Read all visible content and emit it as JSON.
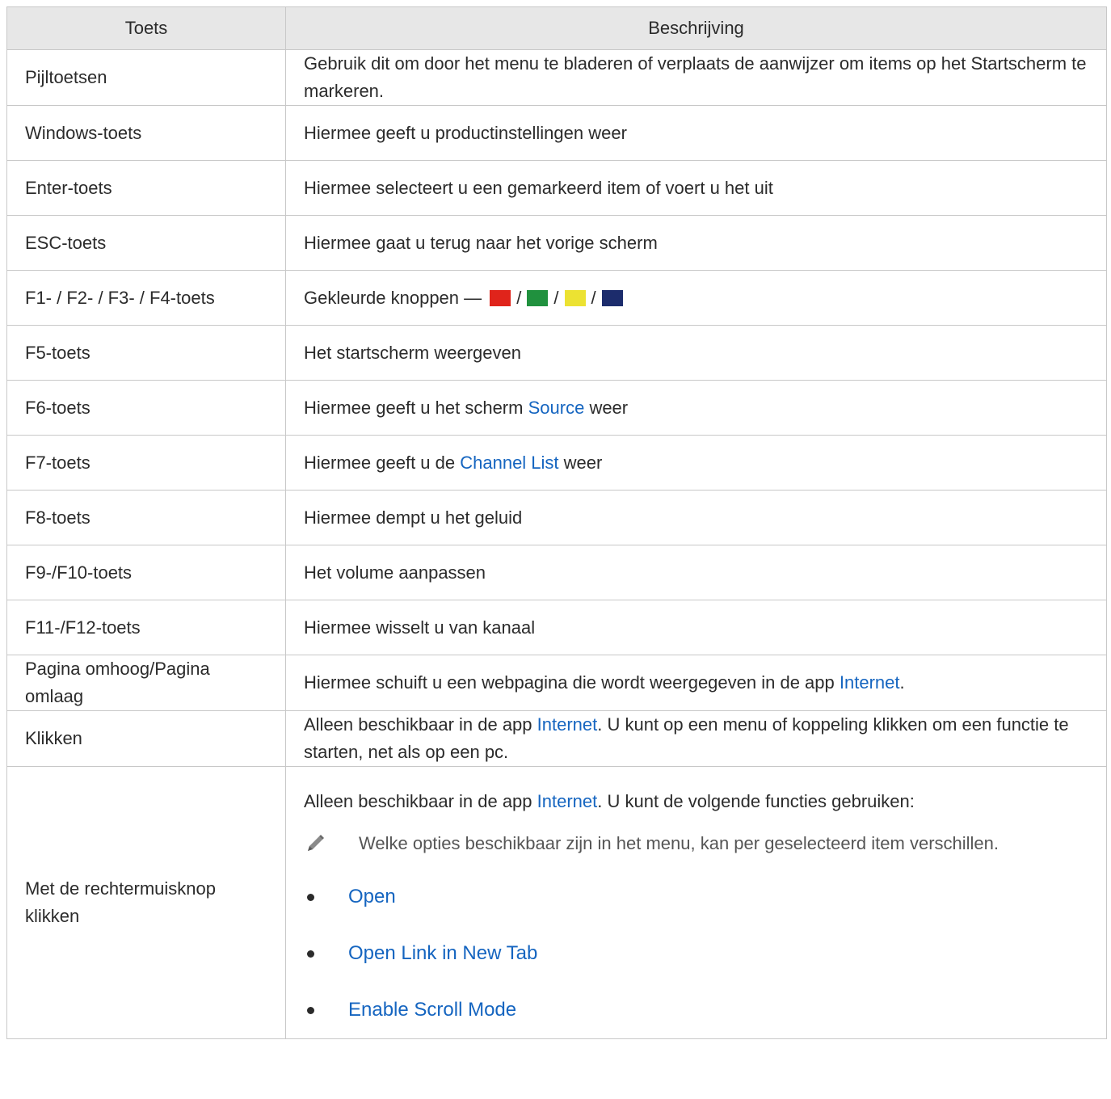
{
  "header": {
    "col1": "Toets",
    "col2": "Beschrijving"
  },
  "rows": [
    {
      "key": "Pijltoetsen",
      "desc": "Gebruik dit om door het menu te bladeren of verplaats de aanwijzer om items op het Startscherm te markeren."
    },
    {
      "key": "Windows-toets",
      "desc": "Hiermee geeft u productinstellingen weer"
    },
    {
      "key": "Enter-toets",
      "desc": "Hiermee selecteert u een gemarkeerd item of voert u het uit"
    },
    {
      "key": "ESC-toets",
      "desc": "Hiermee gaat u terug naar het vorige scherm"
    },
    {
      "key": "F1- / F2- / F3- / F4-toets",
      "desc": "Gekleurde knoppen —",
      "sep": "/"
    },
    {
      "key": "F5-toets",
      "desc": "Het startscherm weergeven"
    },
    {
      "key": "F6-toets",
      "desc_pre": "Hiermee geeft u het scherm",
      "link": "Source",
      "desc_post": "weer"
    },
    {
      "key": "F7-toets",
      "desc_pre": "Hiermee geeft u de",
      "link": "Channel List",
      "desc_post": "weer"
    },
    {
      "key": "F8-toets",
      "desc": "Hiermee dempt u het geluid"
    },
    {
      "key": "F9-/F10-toets",
      "desc": "Het volume aanpassen"
    },
    {
      "key": "F11-/F12-toets",
      "desc": "Hiermee wisselt u van kanaal"
    },
    {
      "key": "Pagina omhoog/Pagina omlaag",
      "desc_pre": "Hiermee schuift u een webpagina die wordt weergegeven in de app",
      "link": "Internet",
      "desc_post": "."
    },
    {
      "key": "Klikken",
      "desc_pre": "Alleen beschikbaar in de app",
      "link": "Internet",
      "desc_post": ". U kunt op een menu of koppeling klikken om een functie te starten, net als op een pc."
    },
    {
      "key": "Met de rechtermuisknop klikken",
      "desc_pre": "Alleen beschikbaar in de app",
      "link": "Internet",
      "desc_post": ". U kunt de volgende functies gebruiken:",
      "note": "Welke opties beschikbaar zijn in het menu, kan per geselecteerd item verschillen.",
      "options": [
        "Open",
        "Open Link in New Tab",
        "Enable Scroll Mode"
      ]
    }
  ],
  "colors": {
    "link": "#1565c0",
    "red": "#e0241b",
    "green": "#20913e",
    "yellow": "#ece232",
    "blue": "#1c2c6c",
    "header_bg": "#e7e7e7"
  },
  "icons": {
    "note": "pencil-icon"
  }
}
